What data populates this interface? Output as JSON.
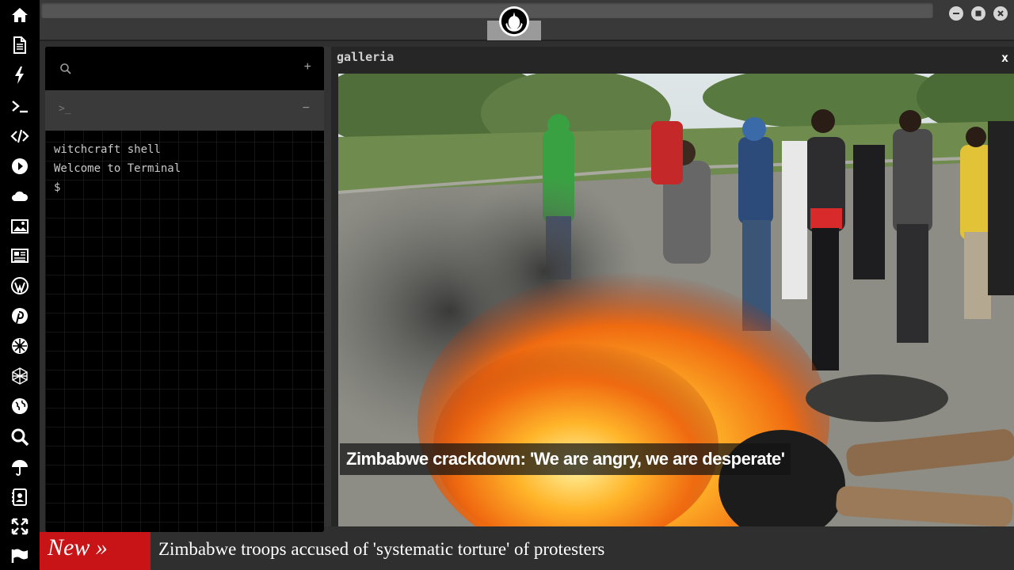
{
  "sidebar": {
    "icons": [
      "home-icon",
      "document-icon",
      "lightning-icon",
      "terminal-icon",
      "code-icon",
      "play-icon",
      "cloud-icon",
      "image-icon",
      "newspaper-icon",
      "wordpress-icon",
      "pinterest-icon",
      "galactic-empire-icon",
      "network-sphere-icon",
      "globe-icon",
      "search-icon",
      "umbrella-icon",
      "contact-card-icon",
      "fullscreen-icon",
      "flag-icon"
    ]
  },
  "window": {
    "logo": "rebel-alliance-icon",
    "controls": [
      "minimize-icon",
      "maximize-icon",
      "close-icon"
    ]
  },
  "terminal": {
    "add_label": "+",
    "tab_prompt": ">_",
    "collapse_label": "−",
    "lines": [
      "witchcraft shell",
      "Welcome to Terminal",
      "$"
    ]
  },
  "gallery": {
    "title": "galleria",
    "close_label": "x",
    "caption": "Zimbabwe crackdown: 'We are angry, we are desperate'"
  },
  "ticker": {
    "badge": "New »",
    "headline": "Zimbabwe troops accused of 'systematic torture' of protesters"
  },
  "colors": {
    "sidebar_bg": "#000000",
    "ticker_badge": "#c81416",
    "terminal_bg": "#000000",
    "frame_bg": "#2f2f2f"
  }
}
